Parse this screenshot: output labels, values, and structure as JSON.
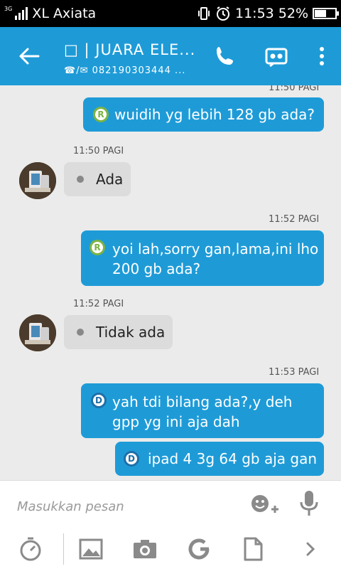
{
  "status": {
    "network": "3G",
    "carrier": "XL Axiata",
    "time": "11:53",
    "battery": "52%",
    "battery_level": 0.52
  },
  "header": {
    "title": "□ | JUARA ELE...",
    "subtitle_prefix": "☎/✉",
    "subtitle": "082190303444 ...",
    "icons": [
      "back-arrow-icon",
      "phone-icon",
      "contact-card-icon",
      "overflow-menu-icon"
    ]
  },
  "messages": [
    {
      "direction": "out",
      "badge": "R",
      "text_lines": [
        "wuidih yg lebih 128 gb ada?"
      ],
      "time": "11:50 PAGI"
    },
    {
      "direction": "in",
      "time": "11:50 PAGI",
      "text_lines": [
        "Ada"
      ]
    },
    {
      "direction": "out",
      "time": "11:52 PAGI",
      "badge": "R",
      "text_lines": [
        "yoi lah,sorry gan,lama,ini lho",
        "200 gb ada?"
      ]
    },
    {
      "direction": "in",
      "time": "11:52 PAGI",
      "text_lines": [
        "Tidak ada"
      ]
    },
    {
      "direction": "out",
      "time": "11:53 PAGI",
      "badge": "D",
      "text_lines": [
        "yah tdi bilang ada?,y deh",
        "gpp yg ini aja dah"
      ]
    },
    {
      "direction": "out",
      "badge": "D",
      "text_lines": [
        "ipad 4 3g 64 gb aja gan"
      ]
    }
  ],
  "composer": {
    "placeholder": "Masukkan pesan",
    "icons": [
      "emoji-add-icon",
      "microphone-icon"
    ],
    "toolbar": [
      "timer-icon",
      "image-icon",
      "camera-icon",
      "refresh-icon",
      "document-icon",
      "chevron-right-icon"
    ]
  },
  "colors": {
    "accent": "#1e9bd7",
    "incoming_bubble": "#dcdcdc",
    "background": "#ebebeb",
    "badge_r": "#7db343",
    "badge_d": "#1e6fa8"
  }
}
